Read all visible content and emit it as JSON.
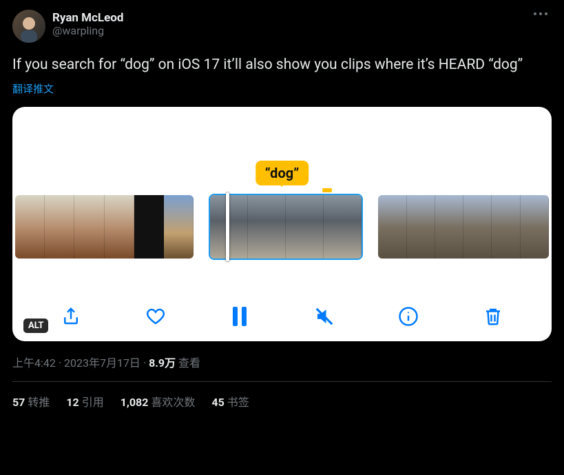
{
  "author": {
    "display_name": "Ryan McLeod",
    "handle": "@warpling"
  },
  "body": "If you search for “dog” on iOS 17 it’ll also show you clips where it’s HEARD “dog”",
  "translate_label": "翻译推文",
  "media": {
    "tooltip": "“dog”",
    "alt_badge": "ALT",
    "controls": {
      "share": "share-icon",
      "like": "heart-icon",
      "pause": "pause-icon",
      "mute": "speaker-muted-icon",
      "info": "info-icon",
      "delete": "trash-icon"
    }
  },
  "meta": {
    "time": "上午4:42",
    "dot1": " · ",
    "date": "2023年7月17日",
    "dot2": " · ",
    "views_count": "8.9万",
    "views_label": " 查看"
  },
  "stats": {
    "retweets_count": "57",
    "retweets_label": "转推",
    "quotes_count": "12",
    "quotes_label": "引用",
    "likes_count": "1,082",
    "likes_label": "喜欢次数",
    "bookmarks_count": "45",
    "bookmarks_label": "书签"
  }
}
